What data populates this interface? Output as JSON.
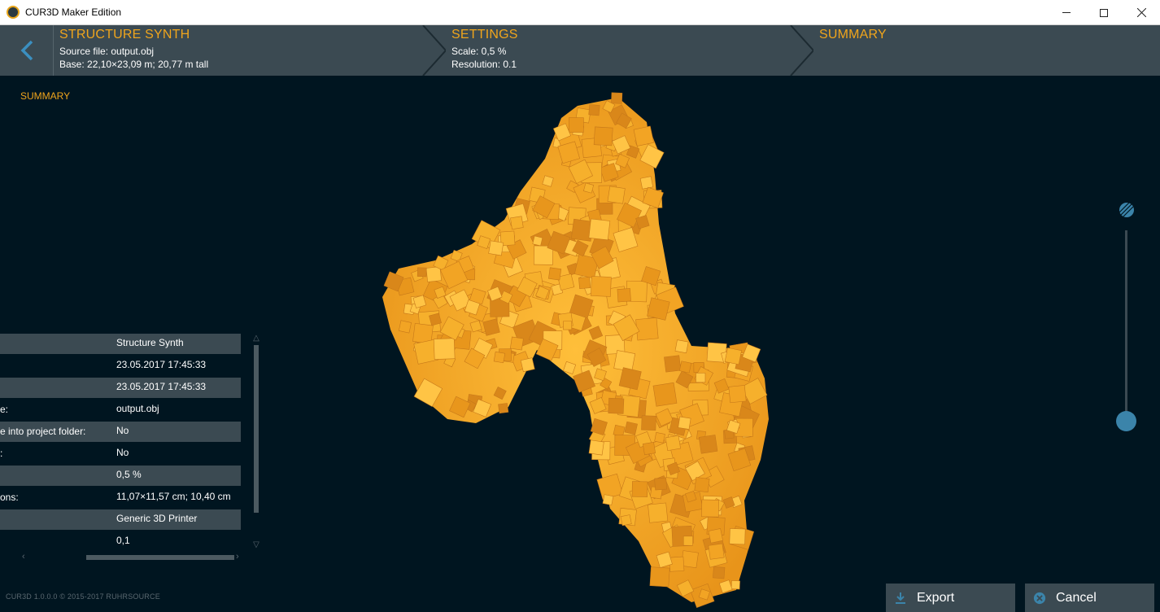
{
  "window": {
    "title": "CUR3D Maker Edition"
  },
  "header": {
    "steps": [
      {
        "title": "STRUCTURE SYNTH",
        "lines": [
          "Source file:  output.obj",
          "Base:  22,10×23,09 m; 20,77 m tall"
        ]
      },
      {
        "title": "SETTINGS",
        "lines": [
          "Scale:  0,5 %",
          "Resolution:  0.1"
        ]
      },
      {
        "title": "SUMMARY",
        "lines": []
      }
    ]
  },
  "summary": {
    "label": "SUMMARY",
    "rows": [
      {
        "key": "",
        "value": "Structure Synth"
      },
      {
        "key": "",
        "value": "23.05.2017 17:45:33"
      },
      {
        "key": "",
        "value": "23.05.2017 17:45:33"
      },
      {
        "key": "e:",
        "value": "output.obj"
      },
      {
        "key": "e into project folder:",
        "value": "No"
      },
      {
        "key": ":",
        "value": "No"
      },
      {
        "key": "",
        "value": "0,5 %"
      },
      {
        "key": "ons:",
        "value": "11,07×11,57 cm; 10,40 cm"
      },
      {
        "key": "",
        "value": "Generic 3D Printer"
      },
      {
        "key": "",
        "value": "0,1"
      }
    ]
  },
  "footer": {
    "text": "CUR3D  1.0.0.0  © 2015-2017 RUHRSOURCE"
  },
  "buttons": {
    "export": "Export",
    "cancel": "Cancel"
  },
  "zoom": {
    "level": 0.0
  },
  "colors": {
    "accent": "#f0a51c",
    "panel": "#3b4a52",
    "background": "#001520",
    "model": "#f4a623",
    "slider": "#3b84aa"
  },
  "icons": [
    "app-logo-icon",
    "back-arrow-icon",
    "zoom-icon",
    "download-icon",
    "cancel-circle-icon"
  ]
}
